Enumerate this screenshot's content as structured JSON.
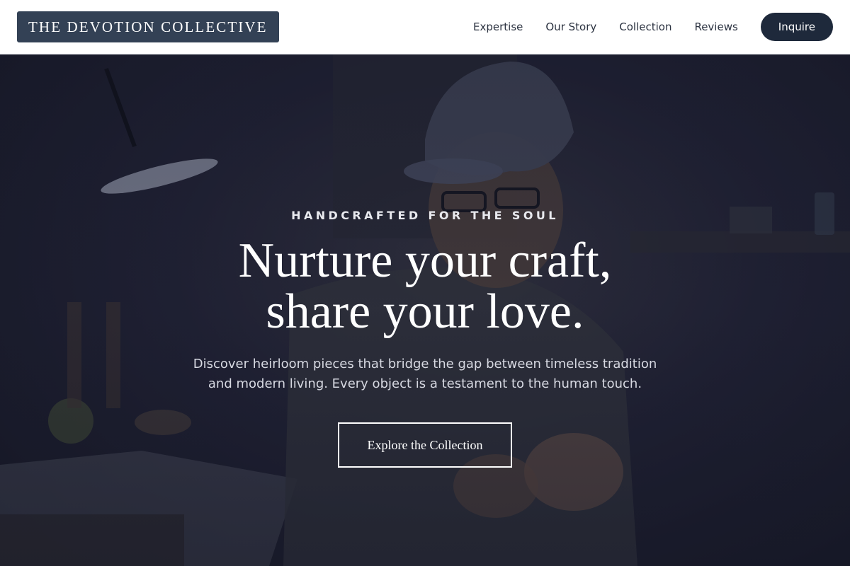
{
  "header": {
    "brand": "THE DEVOTION COLLECTIVE",
    "nav": [
      {
        "label": "Expertise"
      },
      {
        "label": "Our Story"
      },
      {
        "label": "Collection"
      },
      {
        "label": "Reviews"
      }
    ],
    "cta_label": "Inquire"
  },
  "hero": {
    "eyebrow": "HANDCRAFTED FOR THE SOUL",
    "headline_line1": "Nurture your craft,",
    "headline_line2": "share your love.",
    "subtext": "Discover heirloom pieces that bridge the gap between timeless tradition and modern living. Every object is a testament to the human touch.",
    "button_label": "Explore the Collection",
    "background_image": "craftsman-at-workbench-photo"
  },
  "colors": {
    "brand_bg": "#334155",
    "cta_bg": "#1e293b",
    "nav_text": "#2b3240",
    "hero_tint": "#161826"
  }
}
